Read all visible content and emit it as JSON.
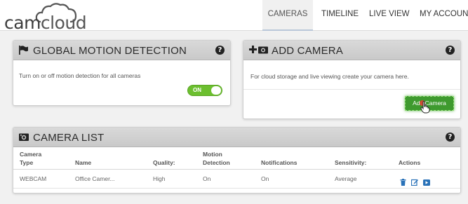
{
  "app": {
    "logo_cam": "cam",
    "logo_cloud": "cloud"
  },
  "nav": {
    "items": [
      {
        "label": "CAMERAS",
        "active": true
      },
      {
        "label": "TIMELINE"
      },
      {
        "label": "LIVE VIEW"
      },
      {
        "label": "MY ACCOUNT"
      }
    ]
  },
  "motion_panel": {
    "title": "GLOBAL MOTION DETECTION",
    "description": "Turn on or off motion detection for all cameras",
    "toggle_label": "ON",
    "icon": "flag-icon",
    "help": "?"
  },
  "add_panel": {
    "title": "ADD CAMERA",
    "description": "For cloud storage and live viewing create your camera here.",
    "button_label": "Add Camera",
    "icon": "plus-camera-icon",
    "help": "?"
  },
  "list_panel": {
    "title": "CAMERA LIST",
    "icon": "camera-icon",
    "help": "?",
    "columns": [
      "Camera Type",
      "Name",
      "Quality:",
      "Motion Detection",
      "Notifications",
      "Sensitivity:",
      "Actions"
    ],
    "columns_split": {
      "type_1": "Camera",
      "type_2": "Type",
      "motion_1": "Motion",
      "motion_2": "Detection"
    },
    "rows": [
      {
        "type": "WEBCAM",
        "name": "Office Camer...",
        "quality": "High",
        "motion": "On",
        "notifications": "On",
        "sensitivity": "Average",
        "actions": [
          "trash-icon",
          "edit-icon",
          "video-icon"
        ]
      }
    ]
  },
  "colors": {
    "accent_green": "#6cbf2f",
    "button_green": "#3e9a2e",
    "action_blue": "#2a72b8",
    "panel_header": "#d3d3d3"
  }
}
